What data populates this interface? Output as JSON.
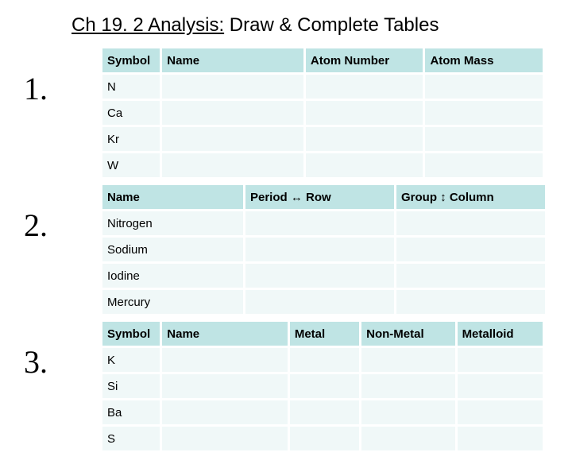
{
  "title": {
    "underlined": "Ch 19. 2 Analysis:",
    "rest": " Draw & Complete Tables"
  },
  "marks": {
    "one": "1.",
    "two": "2.",
    "three": "3."
  },
  "table1": {
    "headers": [
      "Symbol",
      "Name",
      "Atom Number",
      "Atom Mass"
    ],
    "rows": [
      {
        "symbol": "N",
        "name": "",
        "atomNumber": "",
        "atomMass": ""
      },
      {
        "symbol": "Ca",
        "name": "",
        "atomNumber": "",
        "atomMass": ""
      },
      {
        "symbol": "Kr",
        "name": "",
        "atomNumber": "",
        "atomMass": ""
      },
      {
        "symbol": "W",
        "name": "",
        "atomNumber": "",
        "atomMass": ""
      }
    ]
  },
  "table2": {
    "headers": [
      "Name",
      "Period ↔ Row",
      "Group ↕ Column"
    ],
    "rows": [
      {
        "name": "Nitrogen",
        "period": "",
        "group": ""
      },
      {
        "name": "Sodium",
        "period": "",
        "group": ""
      },
      {
        "name": "Iodine",
        "period": "",
        "group": ""
      },
      {
        "name": "Mercury",
        "period": "",
        "group": ""
      }
    ]
  },
  "table3": {
    "headers": [
      "Symbol",
      "Name",
      "Metal",
      "Non-Metal",
      "Metalloid"
    ],
    "rows": [
      {
        "symbol": "K",
        "name": "",
        "metal": "",
        "nonmetal": "",
        "metalloid": ""
      },
      {
        "symbol": "Si",
        "name": "",
        "metal": "",
        "nonmetal": "",
        "metalloid": ""
      },
      {
        "symbol": "Ba",
        "name": "",
        "metal": "",
        "nonmetal": "",
        "metalloid": ""
      },
      {
        "symbol": "S",
        "name": "",
        "metal": "",
        "nonmetal": "",
        "metalloid": ""
      }
    ]
  }
}
